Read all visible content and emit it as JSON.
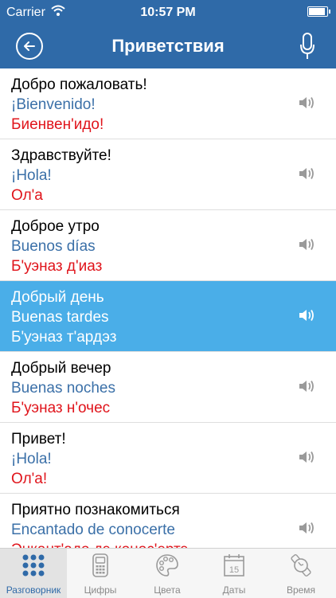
{
  "status": {
    "carrier": "Carrier",
    "time": "10:57 PM"
  },
  "nav": {
    "title": "Приветствия"
  },
  "phrases": [
    {
      "ru": "Добро пожаловать!",
      "es": "¡Bienvenido!",
      "tr": "Биенвен'идо!"
    },
    {
      "ru": "Здравствуйте!",
      "es": "¡Hola!",
      "tr": "Ол'а"
    },
    {
      "ru": "Доброе утро",
      "es": "Buenos días",
      "tr": "Б'уэназ д'иаз"
    },
    {
      "ru": "Добрый день",
      "es": "Buenas tardes",
      "tr": "Б'уэназ т'ардэз"
    },
    {
      "ru": "Добрый вечер",
      "es": "Buenas noches",
      "tr": "Б'уэназ н'очес"
    },
    {
      "ru": "Привет!",
      "es": "¡Hola!",
      "tr": "Ол'а!"
    },
    {
      "ru": "Приятно познакомиться",
      "es": "Encantado de conocerte",
      "tr": "Энкант'адо дэ конос'ертэ"
    }
  ],
  "tabs": [
    {
      "label": "Разговорник",
      "icon": "grid-dots-icon"
    },
    {
      "label": "Цифры",
      "icon": "calculator-icon"
    },
    {
      "label": "Цвета",
      "icon": "palette-icon"
    },
    {
      "label": "Даты",
      "icon": "calendar-icon",
      "day": "15"
    },
    {
      "label": "Время",
      "icon": "watch-icon"
    }
  ],
  "colors": {
    "bar": "#2f6aa8",
    "selected": "#4aaee8",
    "spanish": "#3b70a8",
    "transcription": "#e0141b"
  }
}
